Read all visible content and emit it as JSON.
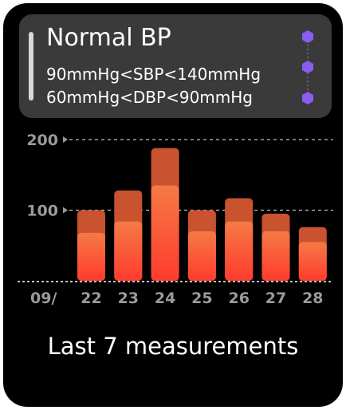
{
  "card": {
    "title": "Normal BP",
    "sbp_range": "90mmHg<SBP<140mmHg",
    "dbp_range": "60mmHg<DBP<90mmHg",
    "page_indicator_count": 3
  },
  "colors": {
    "card_bg": "#3a3a3a",
    "indicator": "#8a5cf0",
    "bar_top": "#c9522f",
    "bar_bottom_light": "#f57a45",
    "bar_bottom_dark": "#ff3b2e",
    "axis_text": "#9a9a9a"
  },
  "chart_data": {
    "type": "bar",
    "categories": [
      "22",
      "23",
      "24",
      "25",
      "26",
      "27",
      "28"
    ],
    "month_label": "09/",
    "series": [
      {
        "values": [
          100,
          128,
          188,
          100,
          117,
          95,
          76
        ]
      },
      {
        "values": [
          68,
          84,
          135,
          70,
          84,
          70,
          55
        ]
      }
    ],
    "yticks": [
      100,
      200
    ],
    "ylim": [
      0,
      200
    ]
  },
  "footer": {
    "caption": "Last 7 measurements"
  }
}
